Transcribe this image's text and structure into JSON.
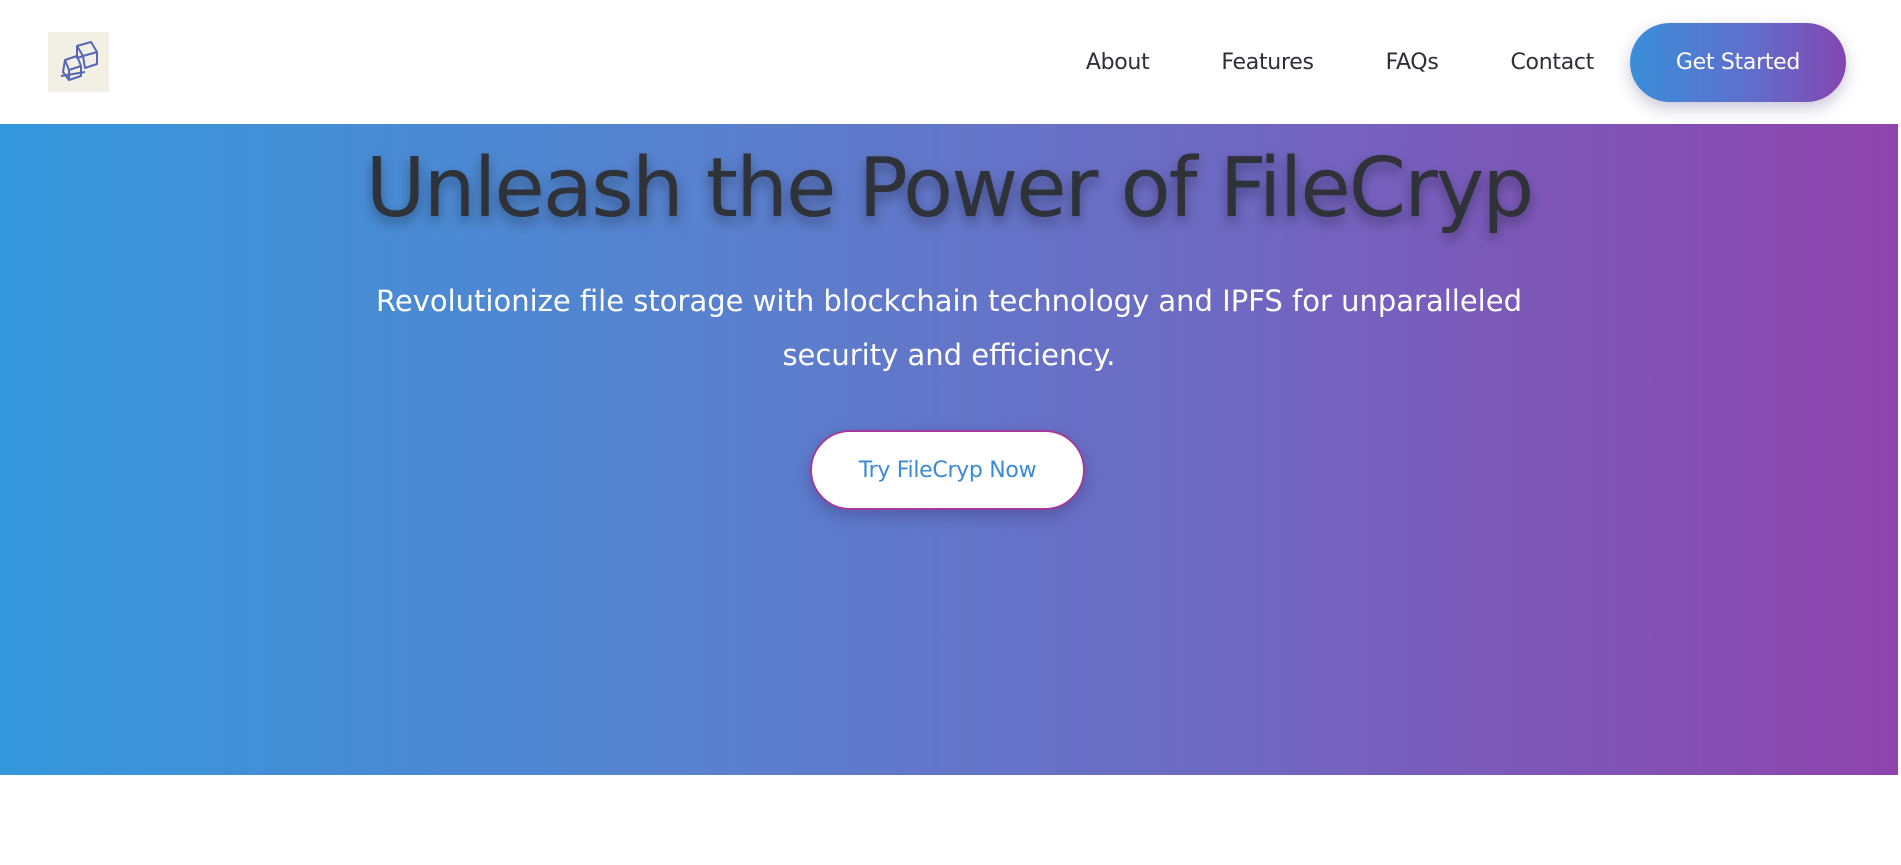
{
  "header": {
    "logo": {
      "icon": "filecryp-logo-icon"
    },
    "nav": {
      "items": [
        {
          "label": "About"
        },
        {
          "label": "Features"
        },
        {
          "label": "FAQs"
        },
        {
          "label": "Contact"
        }
      ],
      "cta_label": "Get Started"
    }
  },
  "hero": {
    "title": "Unleash the Power of FileCryp",
    "subtitle": "Revolutionize file storage with blockchain technology and IPFS for unparalleled security and efficiency.",
    "button_label": "Try FileCryp Now"
  },
  "colors": {
    "gradient_start": "#3598dc",
    "gradient_end": "#8e44ad",
    "title_text": "#2f3339",
    "button_text": "#3a8bd6",
    "button_border": "#a2399b"
  }
}
